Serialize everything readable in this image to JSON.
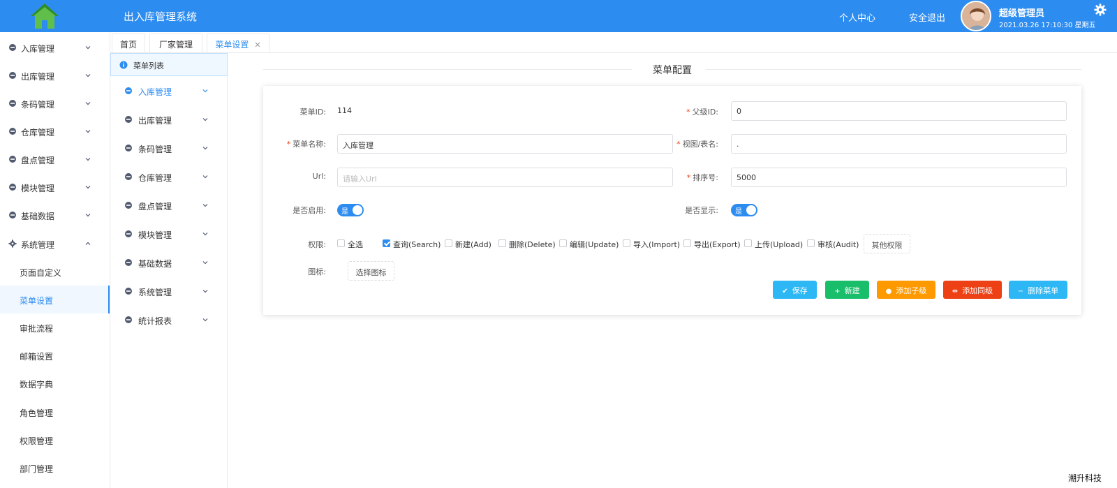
{
  "header": {
    "app_title": "出入库管理系统",
    "links": [
      "个人中心",
      "安全退出"
    ],
    "user_name": "超级管理员",
    "datetime": "2021.03.26 17:10:30 星期五"
  },
  "sidebar": {
    "items": [
      {
        "label": "入库管理"
      },
      {
        "label": "出库管理"
      },
      {
        "label": "条码管理"
      },
      {
        "label": "仓库管理"
      },
      {
        "label": "盘点管理"
      },
      {
        "label": "模块管理"
      },
      {
        "label": "基础数据"
      },
      {
        "label": "系统管理"
      }
    ],
    "subitems": [
      {
        "label": "页面自定义"
      },
      {
        "label": "菜单设置"
      },
      {
        "label": "审批流程"
      },
      {
        "label": "邮箱设置"
      },
      {
        "label": "数据字典"
      },
      {
        "label": "角色管理"
      },
      {
        "label": "权限管理"
      },
      {
        "label": "部门管理"
      }
    ],
    "active_sub": "菜单设置"
  },
  "tabs": [
    {
      "label": "首页"
    },
    {
      "label": "厂家管理"
    },
    {
      "label": "菜单设置"
    }
  ],
  "tree": {
    "header": "菜单列表",
    "items": [
      {
        "label": "入库管理"
      },
      {
        "label": "出库管理"
      },
      {
        "label": "条码管理"
      },
      {
        "label": "仓库管理"
      },
      {
        "label": "盘点管理"
      },
      {
        "label": "模块管理"
      },
      {
        "label": "基础数据"
      },
      {
        "label": "系统管理"
      },
      {
        "label": "统计报表"
      }
    ]
  },
  "form": {
    "section_title": "菜单配置",
    "menu_id_label": "菜单ID:",
    "menu_id_value": "114",
    "parent_id_label": "父级ID:",
    "parent_id_value": "0",
    "menu_name_label": "菜单名称:",
    "menu_name_value": "入库管理",
    "view_label": "视图/表名:",
    "view_value": ".",
    "url_label": "Url:",
    "url_placeholder": "请输入Url",
    "sort_label": "排序号:",
    "sort_value": "5000",
    "enabled_label": "是否启用:",
    "enabled_text": "是",
    "visible_label": "是否显示:",
    "visible_text": "是",
    "perm_label": "权限:",
    "permissions": [
      {
        "label": "全选",
        "checked": false
      },
      {
        "label": "查询(Search)",
        "checked": true
      },
      {
        "label": "新建(Add)",
        "checked": false
      },
      {
        "label": "删除(Delete)",
        "checked": false
      },
      {
        "label": "编辑(Update)",
        "checked": false
      },
      {
        "label": "导入(Import)",
        "checked": false
      },
      {
        "label": "导出(Export)",
        "checked": false
      },
      {
        "label": "上传(Upload)",
        "checked": false
      },
      {
        "label": "审核(Audit)",
        "checked": false
      }
    ],
    "other_perm_label": "其他权限",
    "icon_label": "图标:",
    "select_icon_label": "选择图标"
  },
  "actions": [
    {
      "label": "保存",
      "color": "#2db7f5"
    },
    {
      "label": "新建",
      "color": "#19be6b"
    },
    {
      "label": "添加子级",
      "color": "#ff9900"
    },
    {
      "label": "添加同级",
      "color": "#ed4014"
    },
    {
      "label": "删除菜单",
      "color": "#2db7f5"
    }
  ],
  "footer": {
    "brand": "潮升科技"
  },
  "colors": {
    "primary": "#2d8cf0"
  }
}
